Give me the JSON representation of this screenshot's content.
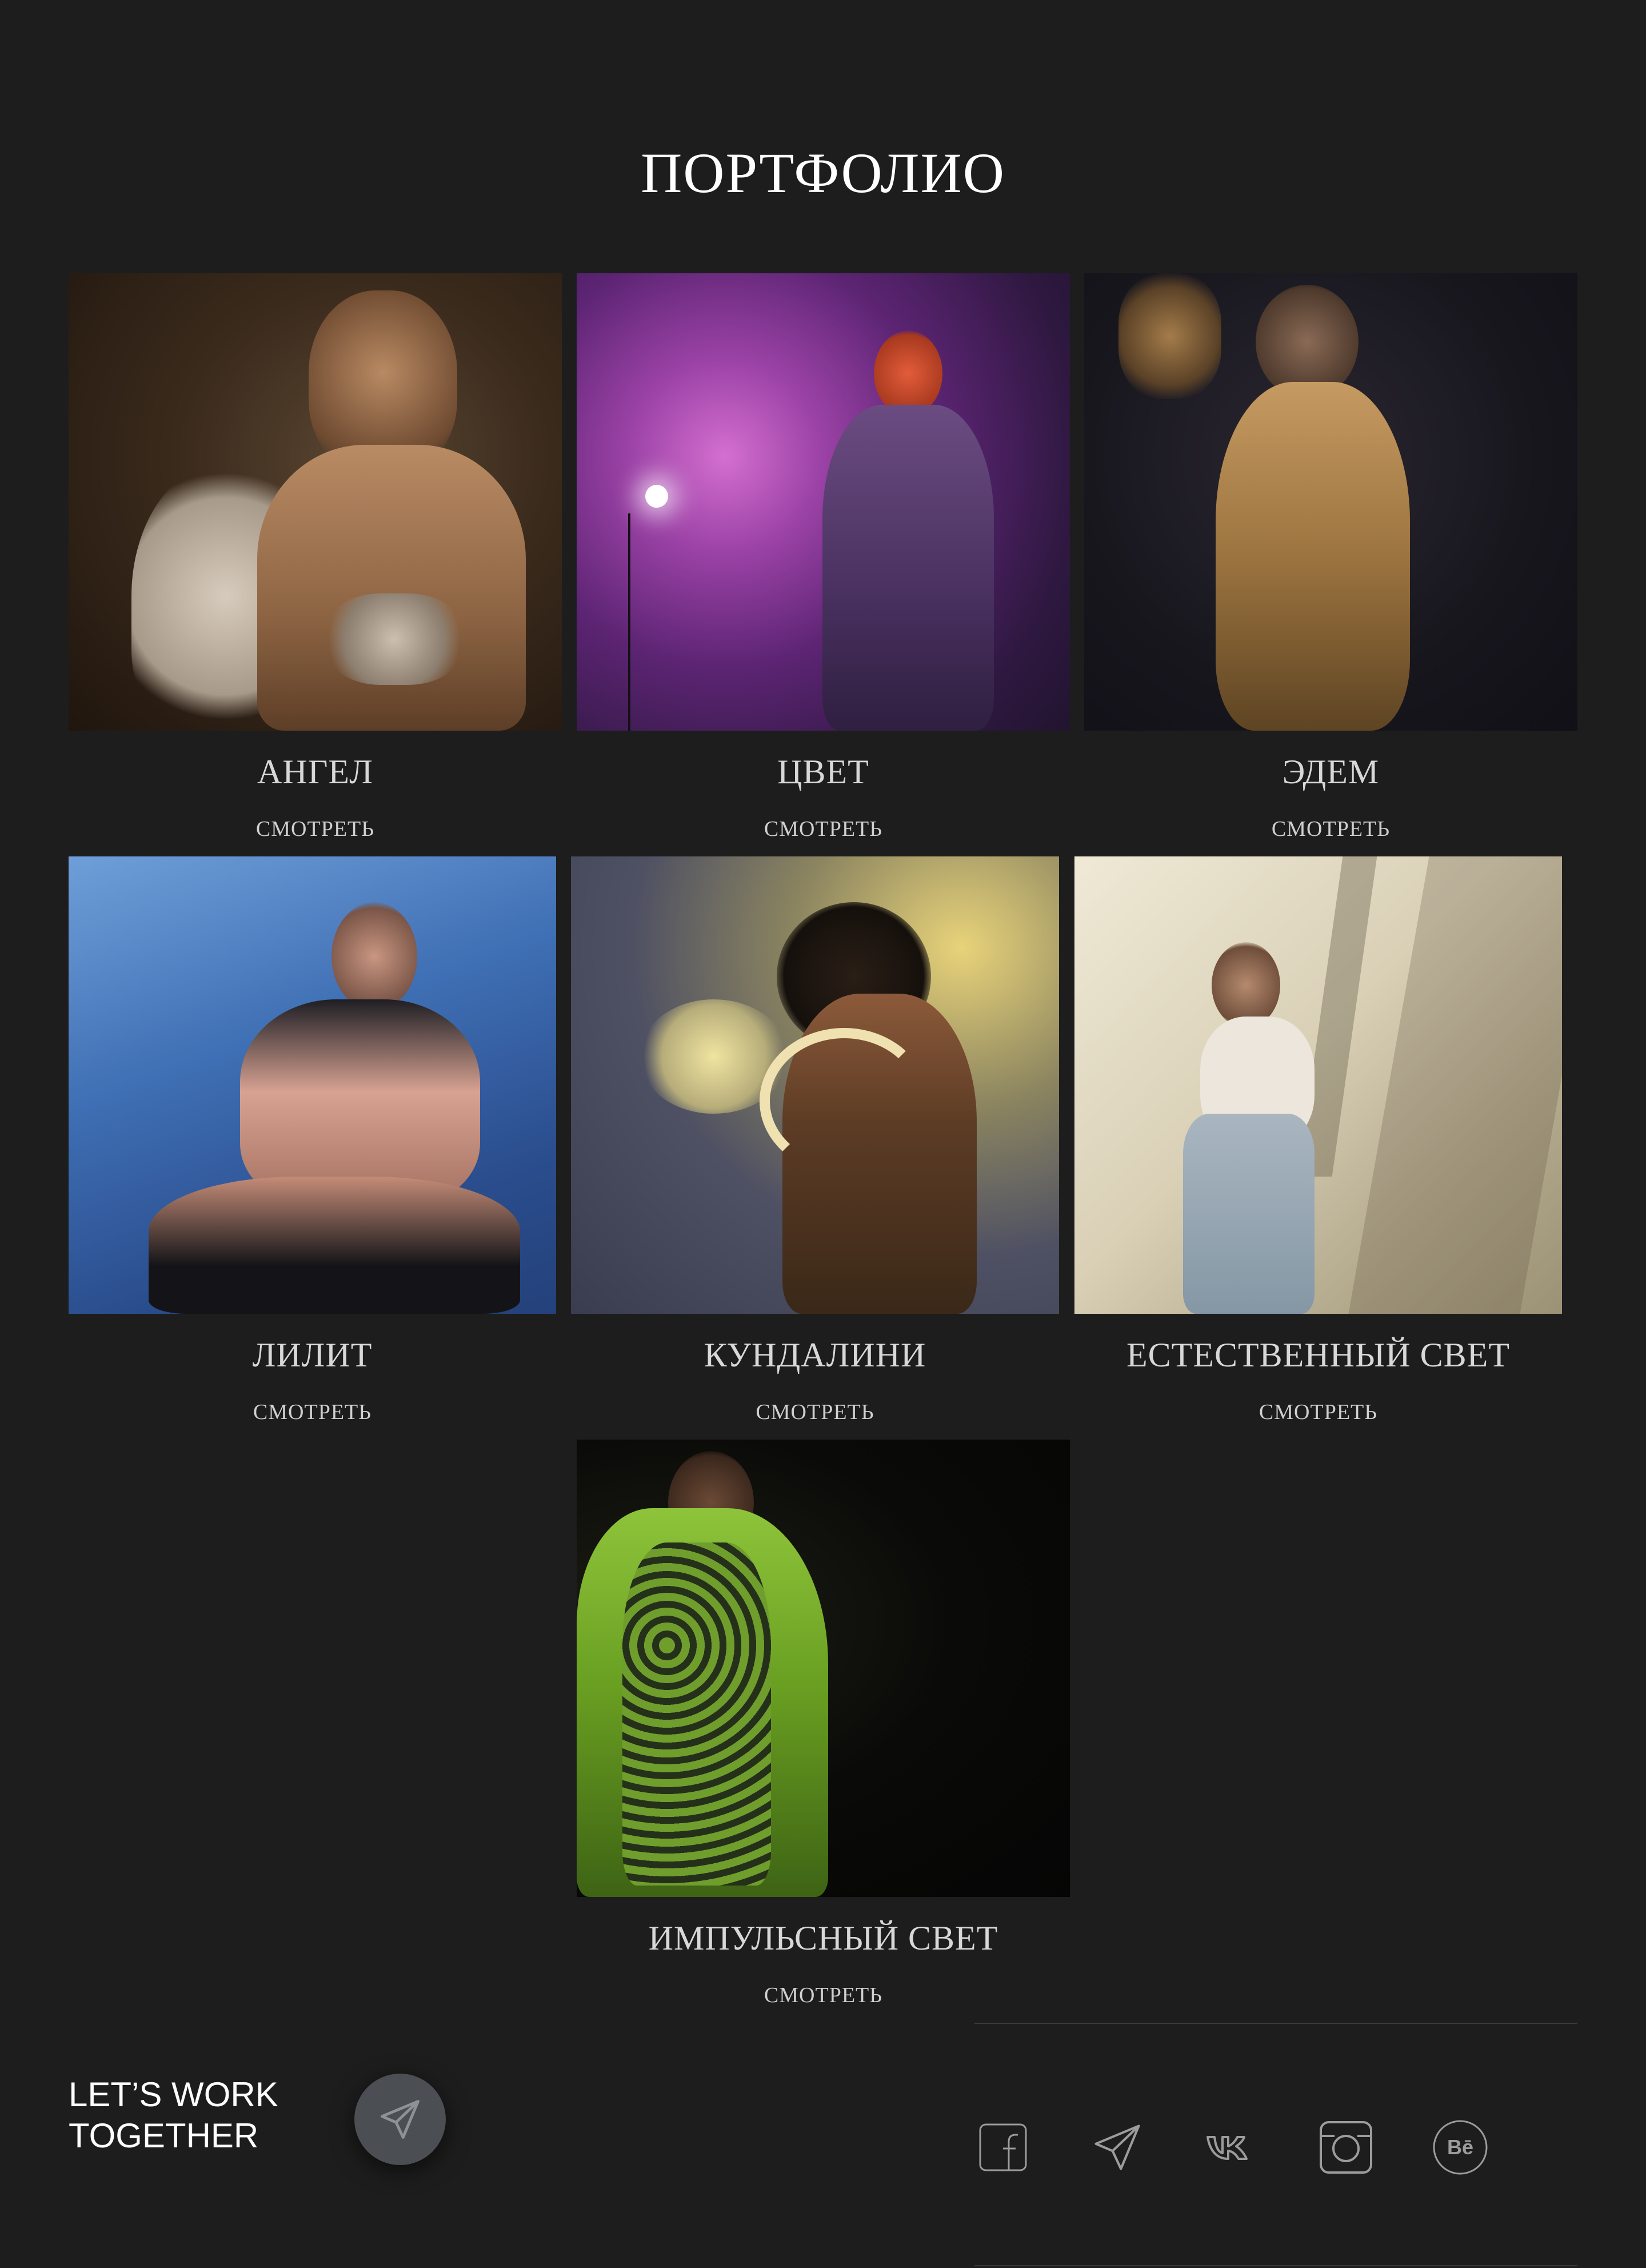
{
  "page": {
    "title": "ПОРТФОЛИО",
    "background": "#1d1d1d"
  },
  "portfolio": {
    "link_label": "СМОТРЕТЬ",
    "items": [
      {
        "title": "АНГЕЛ",
        "link": "СМОТРЕТЬ"
      },
      {
        "title": "ЦВЕТ",
        "link": "СМОТРЕТЬ"
      },
      {
        "title": "ЭДЕМ",
        "link": "СМОТРЕТЬ"
      },
      {
        "title": "ЛИЛИТ",
        "link": "СМОТРЕТЬ"
      },
      {
        "title": "КУНДАЛИНИ",
        "link": "СМОТРЕТЬ"
      },
      {
        "title": "ЕСТЕСТВЕННЫЙ СВЕТ",
        "link": "СМОТРЕТЬ"
      },
      {
        "title": "ИМПУЛЬСНЫЙ СВЕТ",
        "link": "СМОТРЕТЬ"
      }
    ]
  },
  "footer": {
    "cta_line1": "LET’S WORK",
    "cta_line2": "TOGETHER",
    "send_icon": "paper-plane-icon",
    "social": [
      "facebook-icon",
      "telegram-icon",
      "vk-icon",
      "instagram-icon",
      "behance-icon"
    ]
  }
}
